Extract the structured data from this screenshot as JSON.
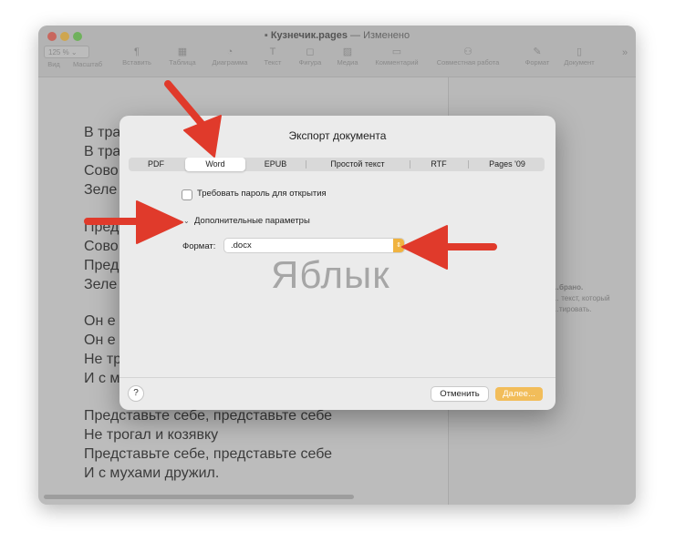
{
  "window": {
    "title_file": "Кузнечик.pages",
    "title_suffix": "— Изменено",
    "zoom": "125 % ⌄",
    "toolbar": [
      {
        "label": "Вид",
        "icon": "sidebar-icon"
      },
      {
        "label": "Масштаб",
        "icon": "zoom-icon"
      },
      {
        "label": "Вставить",
        "icon": "paragraph-icon"
      },
      {
        "label": "Таблица",
        "icon": "table-icon"
      },
      {
        "label": "Диаграмма",
        "icon": "chart-icon"
      },
      {
        "label": "Текст",
        "icon": "text-icon"
      },
      {
        "label": "Фигура",
        "icon": "shape-icon"
      },
      {
        "label": "Медиа",
        "icon": "media-icon"
      },
      {
        "label": "Комментарий",
        "icon": "comment-icon"
      },
      {
        "label": "Совместная работа",
        "icon": "collaborate-icon"
      },
      {
        "label": "Формат",
        "icon": "format-brush-icon"
      },
      {
        "label": "Документ",
        "icon": "document-icon"
      }
    ]
  },
  "document": {
    "lines": [
      "В тра",
      "В тра",
      "Сово",
      "Зеле",
      "Пред",
      "Сово",
      "Пред",
      "Зеле",
      "Он е",
      "Он е",
      "Не тр",
      "И с м",
      "Представьте себе, представьте себе",
      "Не трогал и козявку",
      "Представьте себе, представьте себе",
      "И с мухами дружил."
    ]
  },
  "sidebar": {
    "lines": [
      "…брано.",
      "… текст, который",
      "…тировать."
    ]
  },
  "dialog": {
    "title": "Экспорт документа",
    "tabs": [
      "PDF",
      "Word",
      "EPUB",
      "Простой текст",
      "RTF",
      "Pages '09"
    ],
    "selected_tab": "Word",
    "password_label": "Требовать пароль для открытия",
    "advanced_label": "Дополнительные параметры",
    "format_label": "Формат:",
    "format_value": ".docx",
    "watermark": "Яблык",
    "help": "?",
    "cancel": "Отменить",
    "next": "Далее..."
  },
  "colors": {
    "arrow": "#e03a2b",
    "accent": "#f0b340"
  }
}
